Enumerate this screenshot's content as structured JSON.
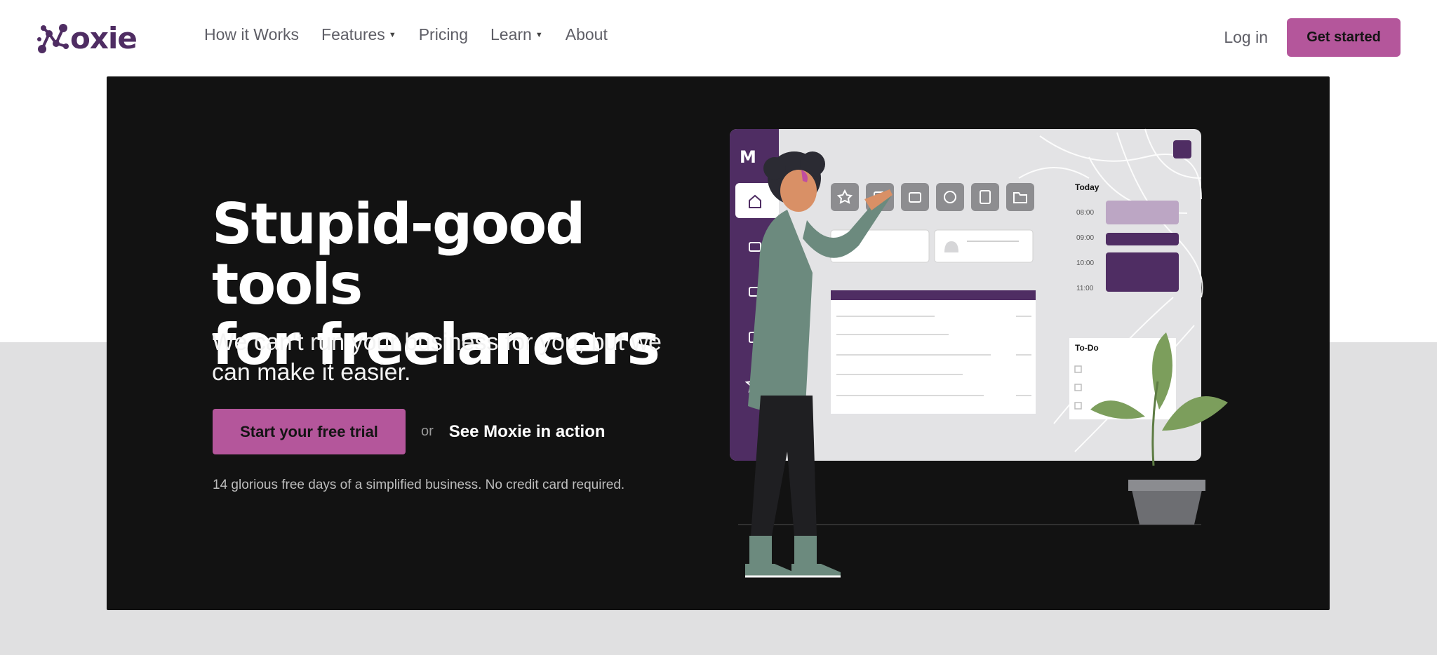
{
  "brand": {
    "name": "Moxie",
    "color": "#4f2d63",
    "accent": "#b4569b"
  },
  "nav": {
    "links": [
      {
        "label": "How it Works",
        "has_dropdown": false
      },
      {
        "label": "Features",
        "has_dropdown": true
      },
      {
        "label": "Pricing",
        "has_dropdown": false
      },
      {
        "label": "Learn",
        "has_dropdown": true
      },
      {
        "label": "About",
        "has_dropdown": false
      }
    ],
    "login": "Log in",
    "cta": "Get started"
  },
  "hero": {
    "headline_line1": "Stupid-good tools",
    "headline_line2": "for freelancers",
    "subheadline": "We can't run your business for you, but we can make it easier.",
    "primary_cta": "Start your free trial",
    "or": "or",
    "secondary_cta": "See Moxie in action",
    "fine_print": "14 glorious free days of a simplified business. No credit card required."
  },
  "illustration": {
    "calendar_title": "Today",
    "times": [
      "08:00",
      "09:00",
      "10:00",
      "11:00"
    ],
    "todo_title": "To-Do",
    "icons": [
      "star-icon",
      "inbox-icon",
      "briefcase-icon",
      "clock-icon",
      "clipboard-icon",
      "folder-icon"
    ]
  }
}
